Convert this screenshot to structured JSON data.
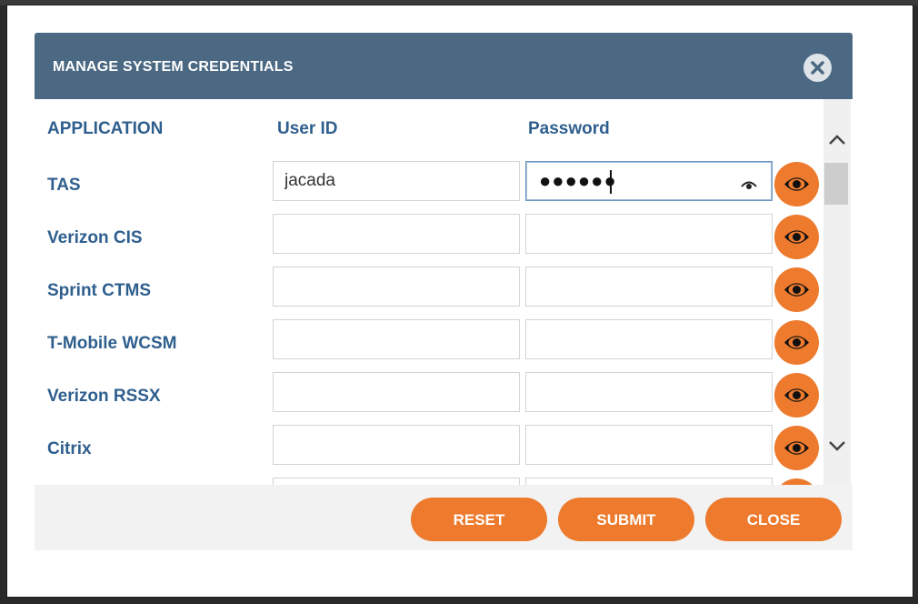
{
  "dialog": {
    "title": "MANAGE SYSTEM CREDENTIALS",
    "close_icon": "close-x-icon"
  },
  "columns": {
    "application": "APPLICATION",
    "user_id": "User ID",
    "password": "Password"
  },
  "rows": [
    {
      "app": "TAS",
      "user_id": "jacada",
      "password_masked": "●●●●●●",
      "focused": true
    },
    {
      "app": "Verizon CIS",
      "user_id": "",
      "password_masked": ""
    },
    {
      "app": "Sprint CTMS",
      "user_id": "",
      "password_masked": ""
    },
    {
      "app": "T-Mobile WCSM",
      "user_id": "",
      "password_masked": ""
    },
    {
      "app": "Verizon RSSX",
      "user_id": "",
      "password_masked": ""
    },
    {
      "app": "Citrix",
      "user_id": "",
      "password_masked": ""
    },
    {
      "app": "",
      "user_id": "",
      "password_masked": ""
    }
  ],
  "footer": {
    "reset": "RESET",
    "submit": "SUBMIT",
    "close": "CLOSE"
  },
  "colors": {
    "header": "#4c6983",
    "accent": "#ed7a2d",
    "label": "#2f5f8e"
  },
  "icons": {
    "show_password": "eye-icon",
    "scroll_up": "chevron-up-icon",
    "scroll_down": "chevron-down-icon"
  }
}
